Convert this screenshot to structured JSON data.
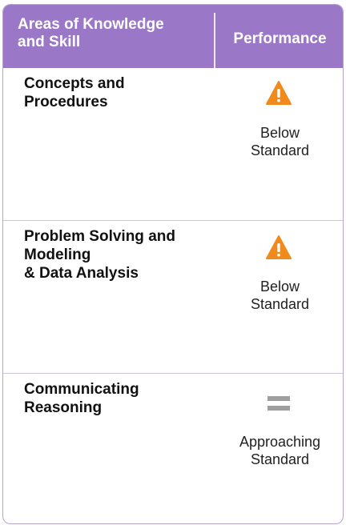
{
  "colors": {
    "header_bg": "#9b77c8",
    "warning_icon": "#f18a1c",
    "equal_icon": "#9e9e9e"
  },
  "header": {
    "areas_label": "Areas of Knowledge\nand Skill",
    "performance_label": "Performance"
  },
  "rows": [
    {
      "area": "Concepts and\nProcedures",
      "icon": "warning-icon",
      "status": "Below\nStandard"
    },
    {
      "area": "Problem Solving and\nModeling\n& Data Analysis",
      "icon": "warning-icon",
      "status": "Below\nStandard"
    },
    {
      "area": "Communicating\nReasoning",
      "icon": "equals-icon",
      "status": "Approaching\nStandard"
    }
  ]
}
